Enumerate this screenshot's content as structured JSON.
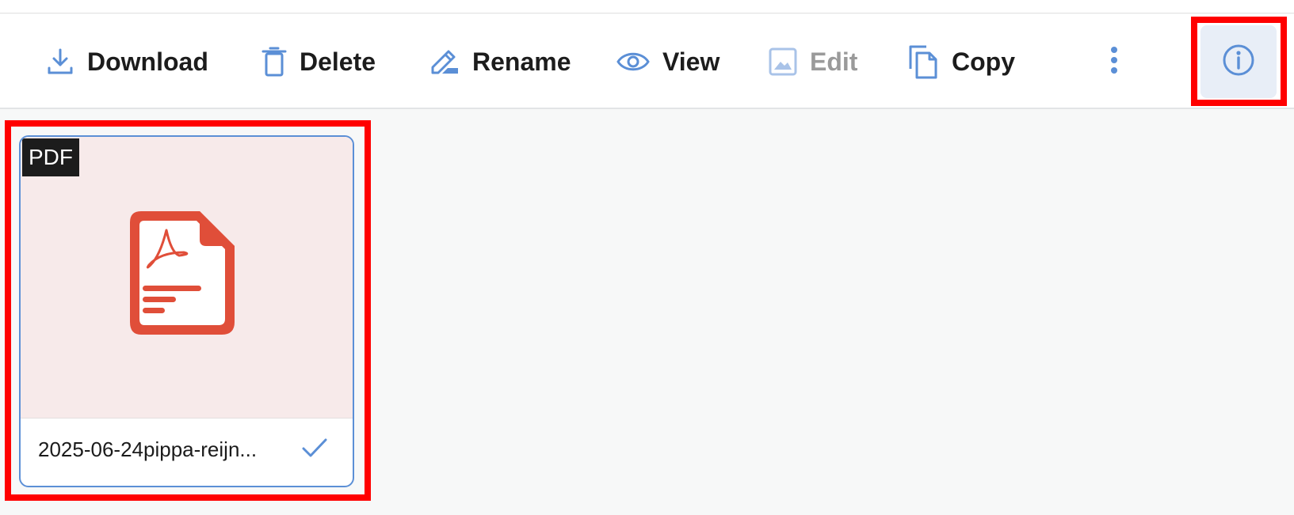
{
  "toolbar": {
    "download_label": "Download",
    "delete_label": "Delete",
    "rename_label": "Rename",
    "view_label": "View",
    "edit_label": "Edit",
    "copy_label": "Copy",
    "more_icon": "more-vertical-icon",
    "info_icon": "info-icon"
  },
  "file": {
    "type_badge": "PDF",
    "name": "2025-06-24pippa-reijn...",
    "selected": true,
    "icon": "pdf-file-icon"
  },
  "colors": {
    "accent": "#5b8fd6",
    "pdf_red": "#e04e39",
    "highlight": "#ff0000",
    "selected_bg": "#e8eef7"
  }
}
